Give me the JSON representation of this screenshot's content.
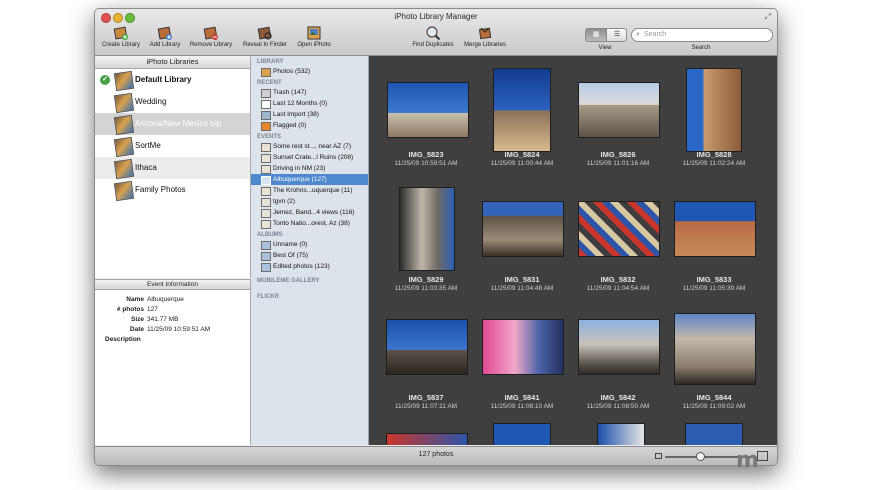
{
  "window": {
    "title": "iPhoto Library Manager"
  },
  "toolbar": {
    "create_library": "Create Library",
    "add_library": "Add Library",
    "remove_library": "Remove Library",
    "reveal_in_finder": "Reveal In Finder",
    "open_iphoto": "Open iPhoto",
    "find_duplicates": "Find Duplicates",
    "merge_libraries": "Merge Libraries",
    "view_label": "View",
    "search_label": "Search",
    "search_placeholder": "Search",
    "view_mode_selected": "grid"
  },
  "libraries": {
    "header": "iPhoto Libraries",
    "items": [
      {
        "label": "Default Library",
        "active": true
      },
      {
        "label": "Wedding"
      },
      {
        "label": "Arizona/New Mexico trip",
        "selected": true
      },
      {
        "label": "SortMe"
      },
      {
        "label": "Ithaca"
      },
      {
        "label": "Family Photos"
      }
    ]
  },
  "event_info": {
    "header": "Event Information",
    "name_key": "Name",
    "name_val": "Albuquerque",
    "photos_key": "# photos",
    "photos_val": "127",
    "size_key": "Size",
    "size_val": "341.77 MB",
    "date_key": "Date",
    "date_val": "11/25/09 10:59:51 AM",
    "desc_key": "Description"
  },
  "sidebar": {
    "library_header": "LIBRARY",
    "library_items": [
      {
        "label": "Photos (532)"
      }
    ],
    "recent_header": "RECENT",
    "recent_items": [
      {
        "label": "Trash (147)"
      },
      {
        "label": "Last 12 Months (0)"
      },
      {
        "label": "Last Import (38)"
      },
      {
        "label": "Flagged (0)"
      }
    ],
    "events_header": "EVENTS",
    "event_items": [
      {
        "label": "Some rest st..., near AZ (7)"
      },
      {
        "label": "Sunset Crate...l Ruins (208)"
      },
      {
        "label": "Driving in NM (23)"
      },
      {
        "label": "Albuquerque (127)",
        "selected": true
      },
      {
        "label": "The Krohns...uquerque (11)"
      },
      {
        "label": "tgvn (2)"
      },
      {
        "label": "Jemez, Band...4 views (116)"
      },
      {
        "label": "Tonto Natio...orest, Az (38)"
      }
    ],
    "albums_header": "ALBUMS",
    "album_items": [
      {
        "label": "Unname (0)"
      },
      {
        "label": "Best Of (75)"
      },
      {
        "label": "Edited photos (123)"
      }
    ],
    "mobileme_header": "MOBILEME GALLERY",
    "flickr_header": "FLICKR"
  },
  "photos": [
    {
      "name": "IMG_5823",
      "date": "11/25/09 10:59:51 AM"
    },
    {
      "name": "IMG_5824",
      "date": "11/25/09 11:00:44 AM"
    },
    {
      "name": "IMG_5826",
      "date": "11/25/09 11:01:16 AM"
    },
    {
      "name": "IMG_5828",
      "date": "11/25/09 11:02:24 AM"
    },
    {
      "name": "IMG_5829",
      "date": "11/25/09 11:03:35 AM"
    },
    {
      "name": "IMG_5831",
      "date": "11/25/09 11:04:48 AM"
    },
    {
      "name": "IMG_5832",
      "date": "11/25/09 11:04:54 AM"
    },
    {
      "name": "IMG_5833",
      "date": "11/25/09 11:05:39 AM"
    },
    {
      "name": "IMG_5837",
      "date": "11/25/09 11:07:11 AM"
    },
    {
      "name": "IMG_5841",
      "date": "11/25/09 11:08:10 AM"
    },
    {
      "name": "IMG_5842",
      "date": "11/25/09 11:08:50 AM"
    },
    {
      "name": "IMG_5844",
      "date": "11/25/09 11:09:02 AM"
    }
  ],
  "status": {
    "text": "127 photos"
  },
  "colors": {
    "selection": "#4e88cf",
    "grid_bg": "#3f3f3f",
    "sidebar_bg": "#dde3ea"
  }
}
